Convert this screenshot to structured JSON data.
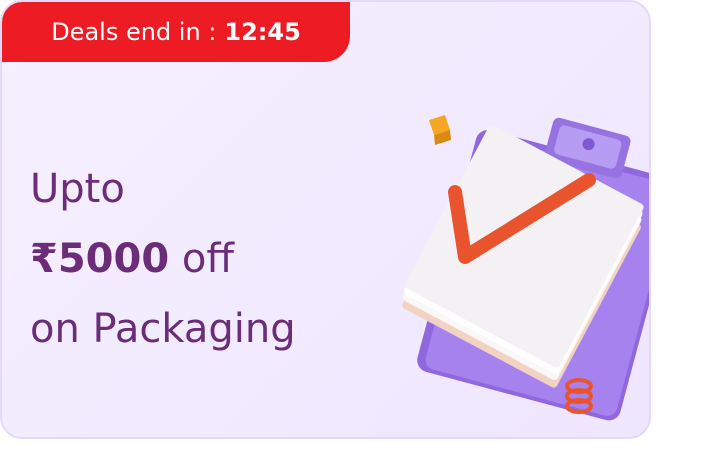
{
  "deal": {
    "prefix": "Deals end in :",
    "timer": "12:45"
  },
  "offer": {
    "line1": "Upto",
    "amount": "₹5000",
    "amount_suffix": "off",
    "line3": "on Packaging"
  },
  "colors": {
    "badge": "#ec1b24",
    "headline": "#6b2d78",
    "card_bg": "#f3ecff",
    "clipboard": "#9a74e6",
    "checkmark": "#e9542f",
    "cube": "#f5a623"
  },
  "icons": {
    "illustration": "clipboard-checklist-icon"
  }
}
